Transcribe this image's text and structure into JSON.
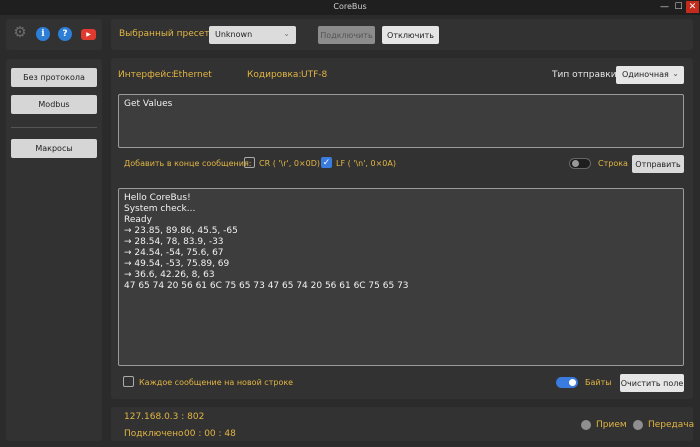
{
  "window": {
    "title": "CoreBus",
    "min": "—",
    "max": "☐",
    "close": "✕"
  },
  "toolbar_icons": [
    "gear-icon",
    "info-icon",
    "help-icon",
    "youtube-icon"
  ],
  "sidebar": {
    "items": [
      {
        "label": "Без протокола"
      },
      {
        "label": "Modbus"
      },
      {
        "label": "Макросы"
      }
    ]
  },
  "top": {
    "preset_label": "Выбранный пресет:",
    "preset_value": "Unknown",
    "connect_label": "Подключить",
    "disconnect_label": "Отключить"
  },
  "main": {
    "interface_label": "Интерфейс:",
    "interface_value": "Ethernet",
    "encoding_label": "Кодировка:",
    "encoding_value": "UTF-8",
    "send_type_label": "Тип отправки:",
    "send_type_value": "Одиночная",
    "message": "Get Values",
    "append_label": "Добавить в конце сообщения:",
    "cr_label": "CR ( '\\r', 0×0D)",
    "cr_checked": false,
    "lf_label": "LF ( '\\n', 0×0A)",
    "lf_checked": true,
    "string_toggle_label": "Строка",
    "string_toggle_on": false,
    "send_label": "Отправить"
  },
  "log": {
    "lines": [
      "Hello CoreBus!",
      "System check...",
      "Ready",
      "→ 23.85, 89.86, 45.5, -65",
      "→ 28.54, 78, 83.9, -33",
      "→ 24.54, -54, 75.6, 67",
      "→ 49.54, -53, 75.89, 69",
      "→ 36.6, 42.26, 8, 63",
      "47 65 74 20 56 61 6C 75 65 73 47 65 74 20 56 61 6C 75 65 73"
    ],
    "newline_label": "Каждое сообщение на новой строке",
    "newline_checked": false,
    "bytes_label": "Байты",
    "bytes_on": true,
    "clear_label": "Очистить поле"
  },
  "status": {
    "address": "127.168.0.3 : 802",
    "connected_label": "Подключено",
    "elapsed": "00 : 00 : 48",
    "rx_label": "Прием",
    "tx_label": "Передача"
  }
}
